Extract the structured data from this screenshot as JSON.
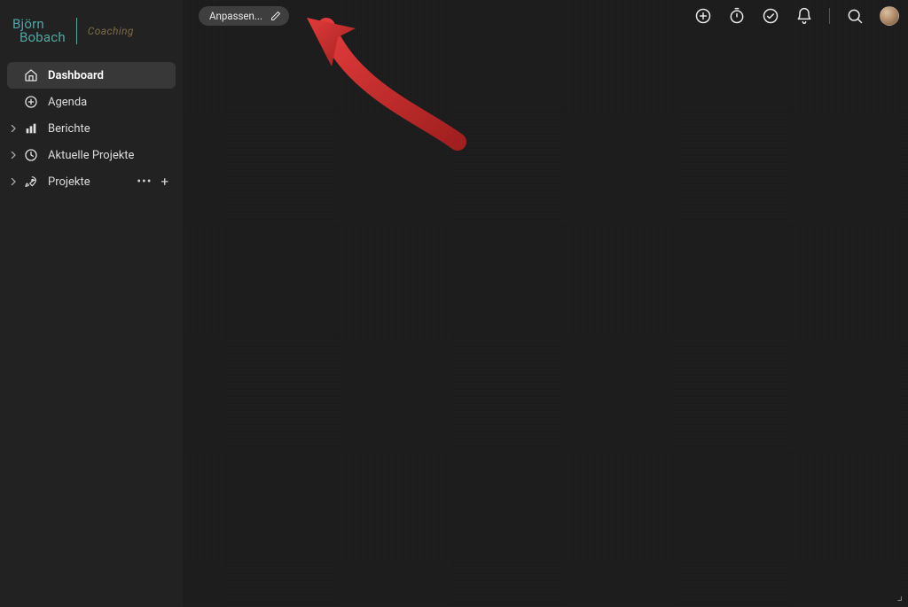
{
  "brand": {
    "line1": "Björn",
    "line2": "Bobach",
    "suffix": "Coaching"
  },
  "sidebar": {
    "items": [
      {
        "label": "Dashboard",
        "icon": "home",
        "expandable": false,
        "active": true
      },
      {
        "label": "Agenda",
        "icon": "plus-circle",
        "expandable": false,
        "active": false
      },
      {
        "label": "Berichte",
        "icon": "bar-chart",
        "expandable": true,
        "active": false
      },
      {
        "label": "Aktuelle Projekte",
        "icon": "clock",
        "expandable": true,
        "active": false
      },
      {
        "label": "Projekte",
        "icon": "rocket",
        "expandable": true,
        "active": false,
        "trailing": true
      }
    ]
  },
  "toolbar": {
    "customize_label": "Anpassen..."
  },
  "annotation": {
    "color": "#d33232",
    "description": "Hand-drawn red arrow pointing to the Anpassen button"
  }
}
